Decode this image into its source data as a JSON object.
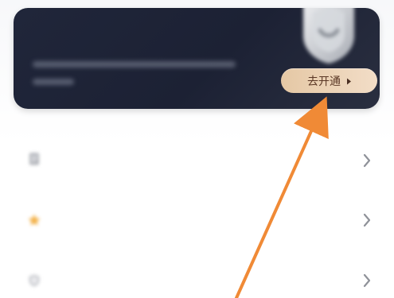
{
  "vip_card": {
    "title": "",
    "subtitle": "",
    "button_label": "去开通",
    "badge_icon": "shield-badge-icon",
    "button_chevron_icon": "triangle-right-icon"
  },
  "menu": {
    "items": [
      {
        "label": "",
        "icon": "document-icon",
        "arrow_icon": "chevron-right-icon"
      },
      {
        "label": "",
        "icon": "star-icon",
        "arrow_icon": "chevron-right-icon"
      },
      {
        "label": "",
        "icon": "shield-icon",
        "arrow_icon": "chevron-right-icon"
      }
    ]
  },
  "annotation": {
    "pointer_icon": "arrow-up-right-icon",
    "color": "#f08a36"
  }
}
